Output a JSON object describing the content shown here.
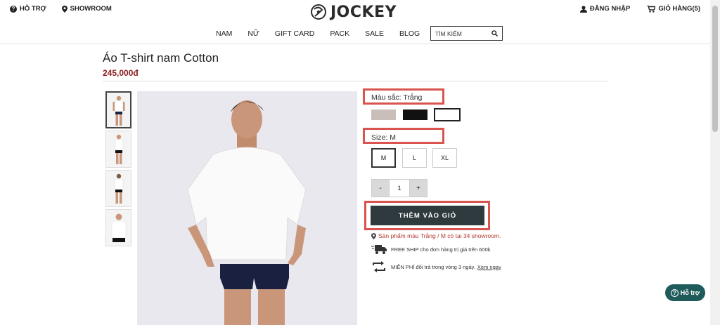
{
  "topbar": {
    "support_label": "HỖ TRỢ",
    "showroom_label": "SHOWROOM",
    "login_label": "ĐĂNG NHẬP",
    "cart_label": "GIỎ HÀNG(5)"
  },
  "brand": {
    "logo_text": "JOCKEY"
  },
  "nav": {
    "items": [
      "NAM",
      "NỮ",
      "GIFT CARD",
      "PACK",
      "SALE",
      "BLOG"
    ],
    "search_placeholder": "TÌM KIẾM"
  },
  "product": {
    "title": "Áo T-shirt nam Cotton",
    "price": "245,000đ",
    "color_label": "Màu sắc: Trắng",
    "colors": [
      {
        "name": "beige",
        "hex": "#c9beba"
      },
      {
        "name": "black",
        "hex": "#111111"
      },
      {
        "name": "white",
        "hex": "#ffffff",
        "selected": true
      }
    ],
    "size_label": "Size: M",
    "sizes": [
      {
        "label": "M",
        "selected": true
      },
      {
        "label": "L"
      },
      {
        "label": "XL"
      }
    ],
    "qty": {
      "minus": "-",
      "value": "1",
      "plus": "+"
    },
    "add_to_cart": "THÊM VÀO GIỎ",
    "availability": "Sản phẩm màu Trắng / M có tại 34 showroom.",
    "perks": {
      "shipping": "FREE SHIP cho đơn hàng trị giá trên 600k",
      "returns": "MIỄN PHÍ đổi trả trong vòng 3 ngày.",
      "returns_link": "Xem ngay"
    }
  },
  "help_button": {
    "label": "Hỗ trợ"
  },
  "colors": {
    "price": "#8b1a1a",
    "highlight": "#d9534f",
    "button": "#2f3a3f",
    "help": "#1f5b5b"
  }
}
